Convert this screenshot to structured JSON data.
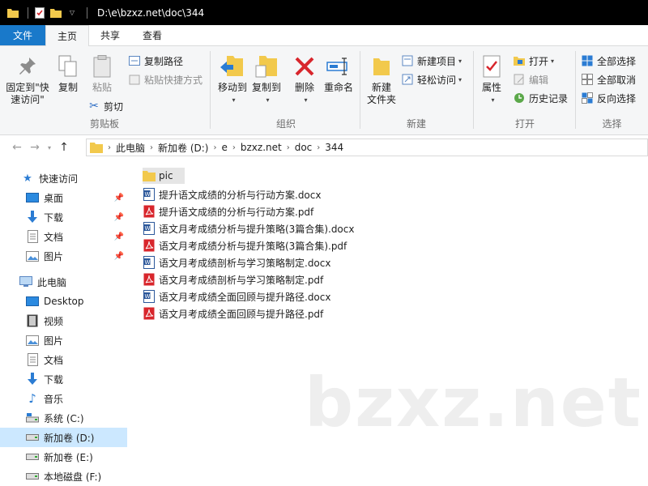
{
  "titlebar": {
    "path": "D:\\e\\bzxz.net\\doc\\344"
  },
  "tabs": {
    "file": "文件",
    "home": "主页",
    "share": "共享",
    "view": "查看"
  },
  "ribbon": {
    "clipboard": {
      "label": "剪贴板",
      "pin_line1": "固定到\"快",
      "pin_line2": "速访问\"",
      "copy": "复制",
      "paste": "粘贴",
      "copy_path": "复制路径",
      "paste_shortcut": "粘贴快捷方式",
      "cut": "剪切"
    },
    "organize": {
      "label": "组织",
      "move_to": "移动到",
      "copy_to": "复制到",
      "delete": "删除",
      "rename": "重命名"
    },
    "new": {
      "label": "新建",
      "new_folder_line1": "新建",
      "new_folder_line2": "文件夹",
      "new_item": "新建项目",
      "easy_access": "轻松访问"
    },
    "open": {
      "label": "打开",
      "properties": "属性",
      "open": "打开",
      "edit": "编辑",
      "history": "历史记录"
    },
    "select": {
      "label": "选择",
      "select_all": "全部选择",
      "select_none": "全部取消",
      "invert": "反向选择"
    }
  },
  "breadcrumbs": [
    "此电脑",
    "新加卷 (D:)",
    "e",
    "bzxz.net",
    "doc",
    "344"
  ],
  "sidebar": {
    "quick_access": "快速访问",
    "quick_items": [
      "桌面",
      "下载",
      "文档",
      "图片"
    ],
    "this_pc": "此电脑",
    "pc_items": [
      "Desktop",
      "视频",
      "图片",
      "文档",
      "下载",
      "音乐",
      "系统 (C:)",
      "新加卷 (D:)",
      "新加卷 (E:)",
      "本地磁盘 (F:)"
    ]
  },
  "files": [
    {
      "name": "pic",
      "type": "folder"
    },
    {
      "name": "提升语文成绩的分析与行动方案.docx",
      "type": "docx"
    },
    {
      "name": "提升语文成绩的分析与行动方案.pdf",
      "type": "pdf"
    },
    {
      "name": "语文月考成绩分析与提升策略(3篇合集).docx",
      "type": "docx"
    },
    {
      "name": "语文月考成绩分析与提升策略(3篇合集).pdf",
      "type": "pdf"
    },
    {
      "name": "语文月考成绩剖析与学习策略制定.docx",
      "type": "docx"
    },
    {
      "name": "语文月考成绩剖析与学习策略制定.pdf",
      "type": "pdf"
    },
    {
      "name": "语文月考成绩全面回顾与提升路径.docx",
      "type": "docx"
    },
    {
      "name": "语文月考成绩全面回顾与提升路径.pdf",
      "type": "pdf"
    }
  ],
  "watermark": "bzxz.net",
  "colors": {
    "file_tab": "#1979ca",
    "selected": "#cce8ff",
    "folder": "#f2c94c",
    "pdf": "#d8262c",
    "word": "#2b579a"
  }
}
